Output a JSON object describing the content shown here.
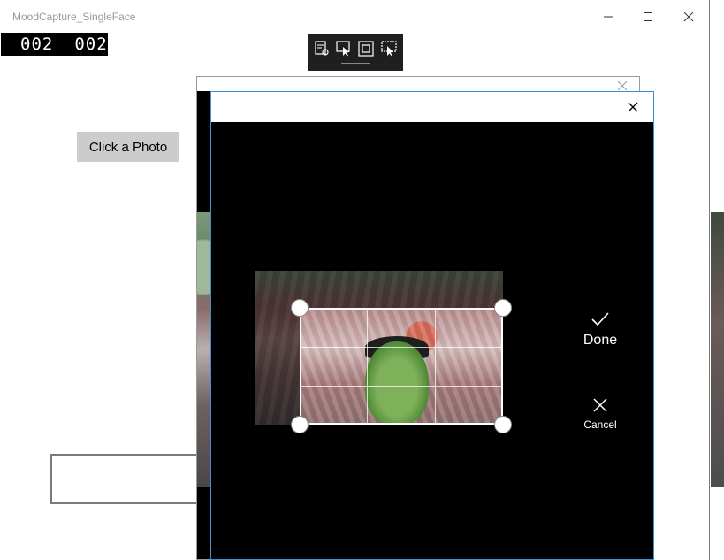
{
  "window": {
    "title": "MoodCapture_SingleFace",
    "minimize_glyph": "—",
    "maximize_glyph": "□",
    "close_glyph": "✕"
  },
  "frame_counter": {
    "left": "002",
    "right": "002"
  },
  "debug_toolbar": {
    "tools": [
      "live-visual-tree-icon",
      "select-element-icon",
      "display-layout-adorners-icon",
      "track-focus-icon"
    ]
  },
  "page": {
    "photo_button_label": "Click a Photo",
    "result_text": ""
  },
  "cropper": {
    "done_label": "Done",
    "cancel_label": "Cancel"
  },
  "colors": {
    "dialog_accent": "#3c8fd6",
    "button_gray": "#cccccc",
    "overlay_black": "#000000"
  }
}
